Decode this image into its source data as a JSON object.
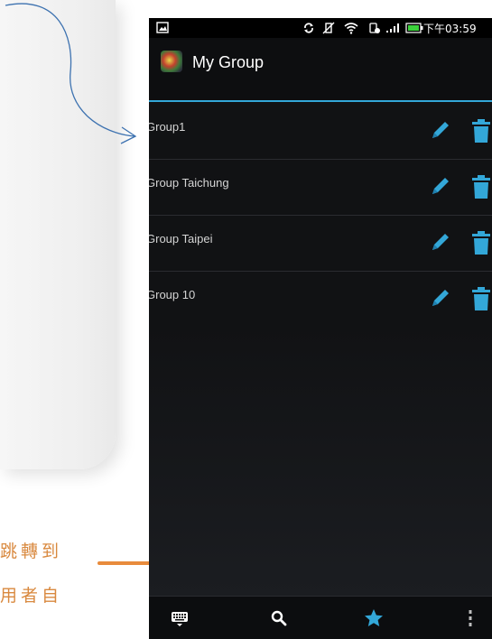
{
  "status_bar": {
    "time": "下午03:59"
  },
  "action_bar": {
    "title": "My Group"
  },
  "groups": [
    {
      "name": "Group1"
    },
    {
      "name": "Group Taichung"
    },
    {
      "name": "Group Taipei"
    },
    {
      "name": "Group 10"
    }
  ],
  "annotation": {
    "line1": "跳轉到",
    "line2": "用者自"
  },
  "colors": {
    "accent": "#33a7d8",
    "annotation": "#d9893f",
    "background": "#111214"
  },
  "icons": {
    "row": [
      "pencil-icon",
      "trash-icon"
    ],
    "bottom_bar": [
      "keyboard-icon",
      "search-icon",
      "star-icon",
      "overflow-menu-icon"
    ]
  }
}
